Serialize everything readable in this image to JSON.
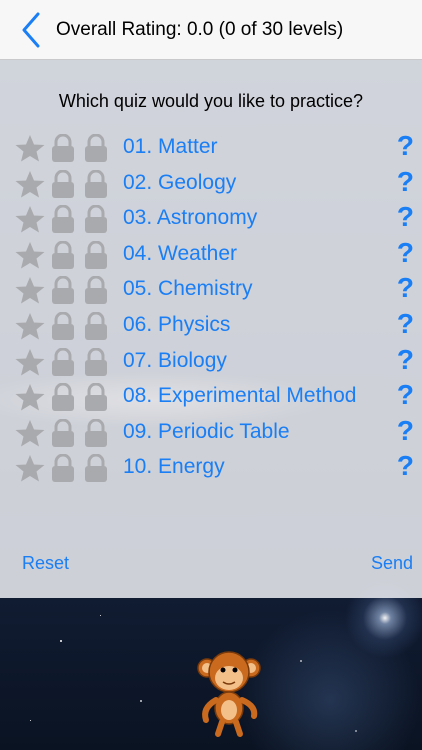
{
  "header": {
    "back_icon": "chevron-left-icon",
    "title": "Overall Rating:  0.0 (0 of 30 levels)"
  },
  "main": {
    "question": "Which quiz would you like to practice?",
    "quizzes": [
      {
        "label": "01. Matter"
      },
      {
        "label": "02. Geology"
      },
      {
        "label": "03. Astronomy"
      },
      {
        "label": "04. Weather"
      },
      {
        "label": "05. Chemistry"
      },
      {
        "label": "06. Physics"
      },
      {
        "label": "07. Biology"
      },
      {
        "label": "08. Experimental Method"
      },
      {
        "label": "09. Periodic Table"
      },
      {
        "label": "10. Energy"
      }
    ],
    "help_symbol": "?",
    "row_icons": [
      "star-icon",
      "lock-icon",
      "lock-icon"
    ]
  },
  "footer": {
    "reset_label": "Reset",
    "send_label": "Send"
  },
  "colors": {
    "accent": "#1a7ef5",
    "icon_gray": "#a9aaad",
    "navbar": "#f7f7f7"
  }
}
